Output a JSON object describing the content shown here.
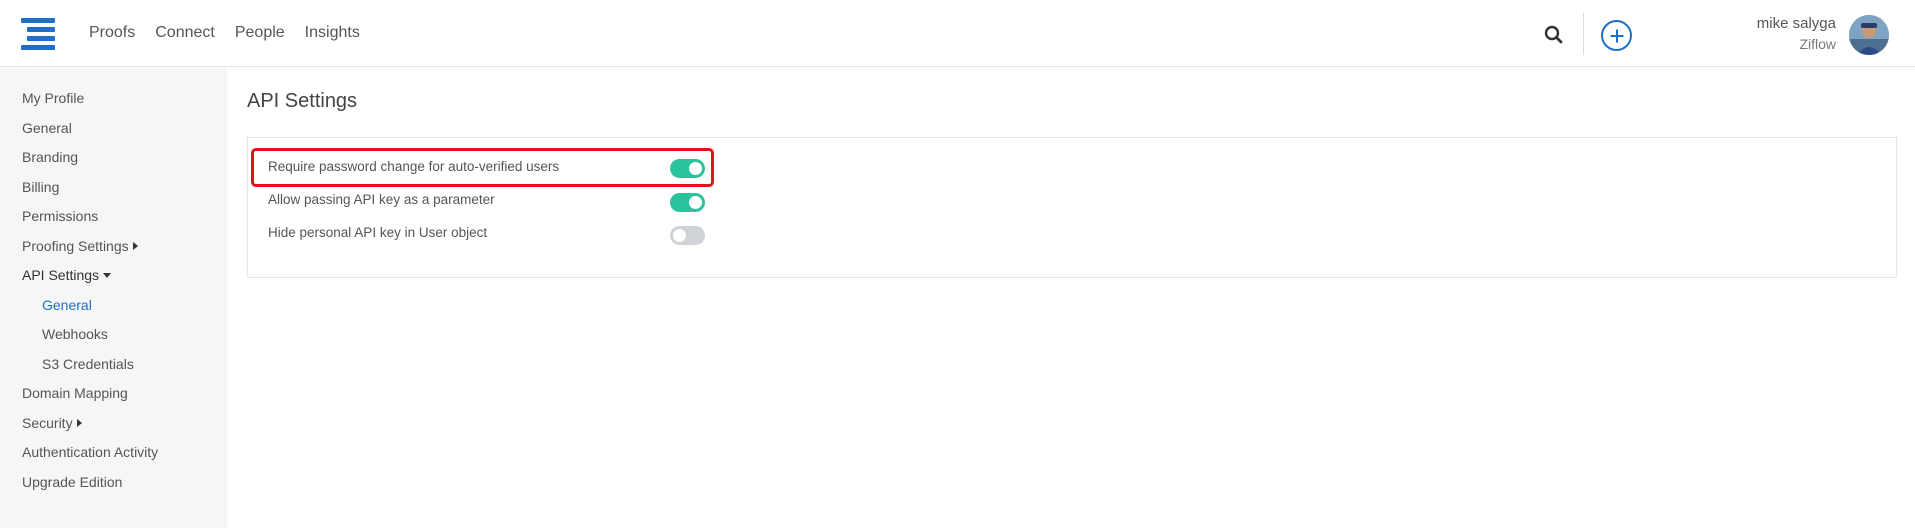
{
  "header": {
    "nav": [
      "Proofs",
      "Connect",
      "People",
      "Insights"
    ],
    "search_icon": "search-icon",
    "add_icon": "plus-circle-icon",
    "user": {
      "name": "mike salyga",
      "org": "Ziflow"
    }
  },
  "sidebar": {
    "items": [
      {
        "label": "My Profile"
      },
      {
        "label": "General"
      },
      {
        "label": "Branding"
      },
      {
        "label": "Billing"
      },
      {
        "label": "Permissions"
      },
      {
        "label": "Proofing Settings"
      },
      {
        "label": "API Settings"
      },
      {
        "label": "General"
      },
      {
        "label": "Webhooks"
      },
      {
        "label": "S3 Credentials"
      },
      {
        "label": "Domain Mapping"
      },
      {
        "label": "Security"
      },
      {
        "label": "Authentication Activity"
      },
      {
        "label": "Upgrade Edition"
      }
    ]
  },
  "main": {
    "title": "API Settings",
    "settings": [
      {
        "label": "Require password change for auto-verified users",
        "enabled": true
      },
      {
        "label": "Allow passing API key as a parameter",
        "enabled": true
      },
      {
        "label": "Hide personal API key in User object",
        "enabled": false
      }
    ]
  },
  "colors": {
    "accent": "#1f6fc6",
    "toggle_on": "#2bc39c",
    "toggle_off": "#cfd3d7",
    "highlight": "#e0121b",
    "sidebar_bg": "#f4f6f8"
  }
}
